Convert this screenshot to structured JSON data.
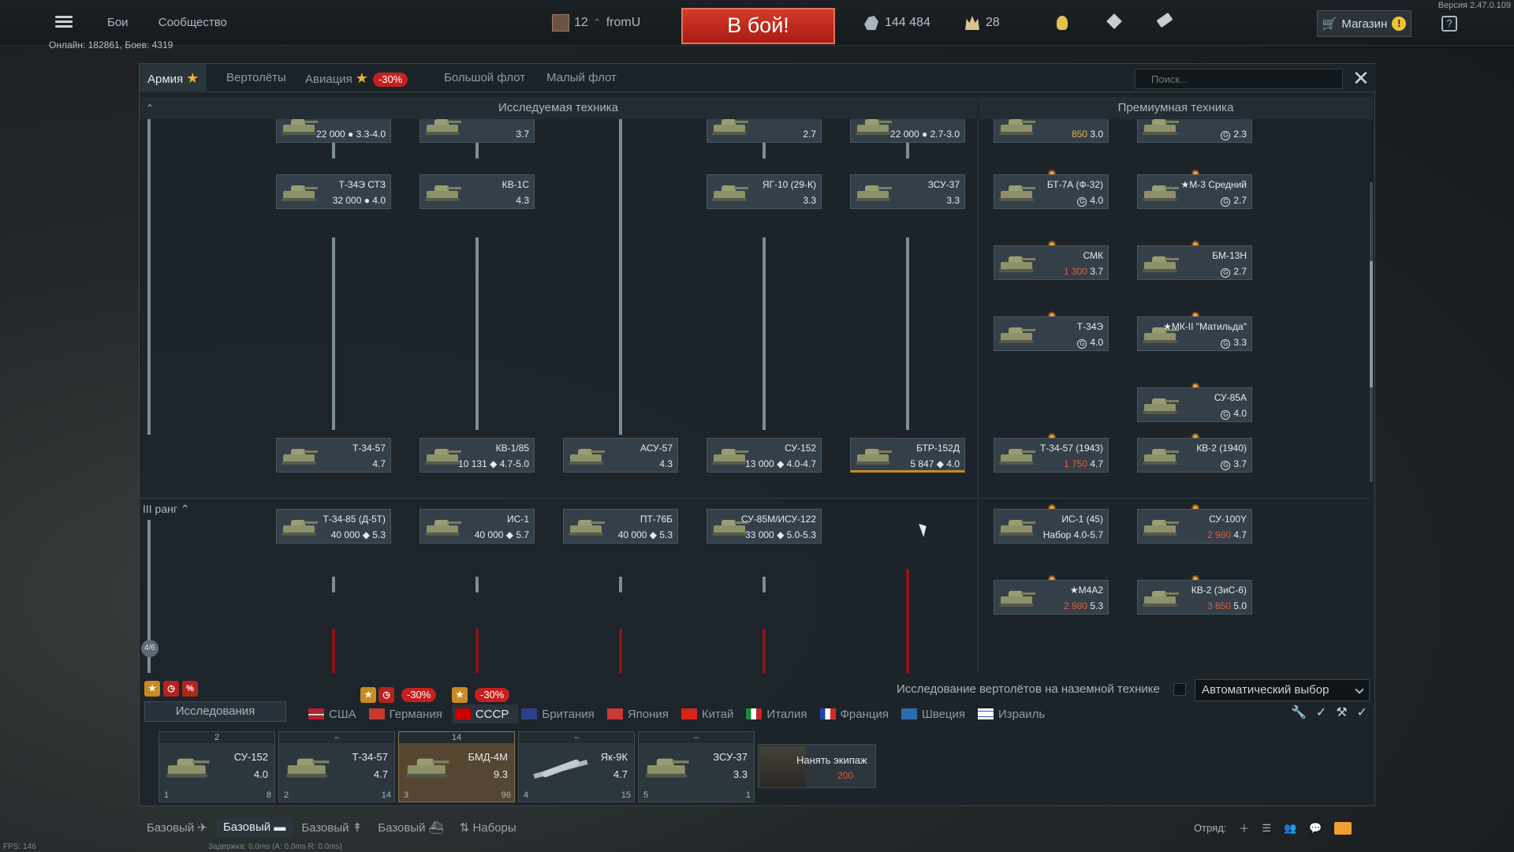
{
  "topbar": {
    "nav": [
      "Бои",
      "Сообщество"
    ],
    "player": {
      "level": "12",
      "name": "fromU"
    },
    "battle_button": "В бой!",
    "silver_lions": "144 484",
    "golden_eagles": "28",
    "shop": "Магазин",
    "help": "?",
    "version": "Версия 2.47.0.109",
    "online": "Онлайн: 182861, Боев: 4319"
  },
  "tabs": {
    "army": "Армия",
    "helicopters": "Вертолёты",
    "aviation": "Авиация",
    "aviation_sale": "-30%",
    "large_fleet": "Большой флот",
    "small_fleet": "Малый флот",
    "search_placeholder": "Поиск..."
  },
  "sections": {
    "research": "Исследуемая техника",
    "premium": "Премиумная техника"
  },
  "rank_label": "III ранг",
  "research_count": "4/6",
  "research_vehicles": [
    {
      "name": "",
      "br": "22 000 ● 3.3-4.0"
    },
    {
      "name": "",
      "br": "3.7"
    },
    {
      "name": "",
      "br": "2.7"
    },
    {
      "name": "",
      "br": "22 000 ● 2.7-3.0"
    },
    {
      "name": "Т-34Э СТЗ",
      "br": "32 000 ● 4.0"
    },
    {
      "name": "КВ-1С",
      "br": "4.3"
    },
    {
      "name": "ЯГ-10 (29-К)",
      "br": "3.3"
    },
    {
      "name": "ЗСУ-37",
      "br": "3.3"
    },
    {
      "name": "Т-34-57",
      "br": "4.7"
    },
    {
      "name": "КВ-1/85",
      "br": "10 131 ◆ 4.7-5.0"
    },
    {
      "name": "АСУ-57",
      "br": "4.3"
    },
    {
      "name": "СУ-152",
      "br": "13 000 ◆ 4.0-4.7"
    },
    {
      "name": "БТР-152Д",
      "br": "5 847 ◆ 4.0"
    },
    {
      "name": "Т-34-85 (Д-5Т)",
      "br": "40 000 ◆ 5.3"
    },
    {
      "name": "ИС-1",
      "br": "40 000 ◆ 5.7"
    },
    {
      "name": "ПТ-76Б",
      "br": "40 000 ◆ 5.3"
    },
    {
      "name": "СУ-85М/ИСУ-122",
      "br": "33 000 ◆ 5.0-5.3"
    }
  ],
  "premium_vehicles": [
    {
      "name": "",
      "price": "850",
      "br": "3.0"
    },
    {
      "name": "",
      "price": "",
      "br": "2.3"
    },
    {
      "name": "БТ-7А (Ф-32)",
      "price": "",
      "br": "4.0"
    },
    {
      "name": "★М-3 Средний",
      "price": "",
      "br": "2.7"
    },
    {
      "name": "СМК",
      "price": "1 300",
      "br": "3.7"
    },
    {
      "name": "БМ-13Н",
      "price": "",
      "br": "2.7"
    },
    {
      "name": "Т-34Э",
      "price": "",
      "br": "4.0"
    },
    {
      "name": "★МК-II \"Матильда\"",
      "price": "",
      "br": "3.3"
    },
    {
      "name": "СУ-85А",
      "price": "",
      "br": "4.0"
    },
    {
      "name": "Т-34-57 (1943)",
      "price": "1 750",
      "br": "4.7"
    },
    {
      "name": "КВ-2 (1940)",
      "price": "",
      "br": "3.7"
    },
    {
      "name": "ИС-1 (45)",
      "price": "Набор",
      "br": "4.0-5.7"
    },
    {
      "name": "СУ-100Y",
      "price": "2 980",
      "br": "4.7"
    },
    {
      "name": "★М4А2",
      "price": "2 980",
      "br": "5.3"
    },
    {
      "name": "КВ-2 (ЗиС-6)",
      "price": "3 850",
      "br": "5.0"
    }
  ],
  "options": {
    "heli_research": "Исследование вертолётов на наземной технике",
    "auto_select": "Автоматический выбор"
  },
  "research_button": "Исследования",
  "nation_sales": [
    "-30%",
    "-30%"
  ],
  "nations": [
    "США",
    "Германия",
    "СССР",
    "Британия",
    "Япония",
    "Китай",
    "Италия",
    "Франция",
    "Швеция",
    "Израиль"
  ],
  "crew_slots": [
    {
      "top": "2",
      "name": "СУ-152",
      "br": "4.0",
      "crew": "1",
      "extra": "8"
    },
    {
      "top": "–",
      "name": "Т-34-57",
      "br": "4.7",
      "crew": "2",
      "extra": "14"
    },
    {
      "top": "14",
      "name": "БМД-4М",
      "br": "9.3",
      "crew": "3",
      "extra": "96"
    },
    {
      "top": "–",
      "name": "Як-9К",
      "br": "4.7",
      "crew": "4",
      "extra": "15"
    },
    {
      "top": "–",
      "name": "ЗСУ-37",
      "br": "3.3",
      "crew": "5",
      "extra": "1"
    }
  ],
  "hire_crew": {
    "label": "Нанять экипаж",
    "cost": "200"
  },
  "presets": [
    "Базовый",
    "Базовый",
    "Базовый",
    "Базовый"
  ],
  "sets": "Наборы",
  "squad": "Отряд:",
  "fps": "FPS: 146",
  "latency": "Задержка: 0.0ms (A: 0.0ms R: 0.0ms)",
  "colors": {
    "battle": "#c42a1c",
    "accent_gold": "#e8b23a",
    "sale_red": "#c61f1f",
    "research_line": "#7e8d95",
    "locked_line": "#8b1419"
  }
}
